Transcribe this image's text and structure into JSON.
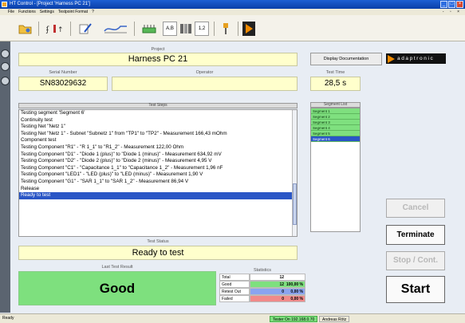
{
  "window": {
    "title": "HT Control - [Project 'Harness PC 21']"
  },
  "menu": {
    "items": [
      "File",
      "Functions",
      "Settings",
      "Testpoint Format",
      "?"
    ]
  },
  "toolbar": {
    "text_buttons": [
      "A,B",
      "1,2"
    ]
  },
  "project": {
    "label": "Project",
    "value": "Harness PC 21"
  },
  "serial": {
    "label": "Serial Number",
    "value": "SN83029632"
  },
  "operator": {
    "label": "Operator",
    "value": ""
  },
  "test_time": {
    "label": "Test Time",
    "value": "28,5 s"
  },
  "display_doc_button": "Display Documentation",
  "brand": {
    "name": "adaptronic",
    "accent": "#f08a00"
  },
  "test_steps": {
    "label": "Test Steps",
    "selected_index": 15,
    "lines": [
      "Testing segment 'Segment 6'",
      "Continuity test",
      "Testing Net \"Netz 1\"",
      "Testing Net \"Netz 1\" - Subnet \"Subnetz 1\" from \"TP1\" to \"TP2\" - Measurement 166,43 mOhm",
      "Component test",
      "Testing Component \"R1\" - \"R 1_1\" to \"R1_2\" - Measurement 122,00 Ohm",
      "Testing Component \"D1\" - \"Diode 1 (plus)\" to \"Diode 1 (minus)\" - Measurement 634,92 mV",
      "Testing Component \"D2\" - \"Diode 2 (plus)\" to \"Diode 2 (minus)\" - Measurement 4,95 V",
      "Testing Component \"C1\" - \"Capacitance 1_1\" to \"Capacitance 1_2\" - Measurement 1,96 nF",
      "Testing Component \"LED1\" - \"LED (plus)\" to \"LED (minus)\" - Measurement 1,90 V",
      "Testing Component \"G1\" - \"SAR 1_1\" to \"SAR 1_2\" - Measurement 86,94 V",
      "Release",
      "Ready to test"
    ]
  },
  "segment_list": {
    "label": "Segment List",
    "items": [
      "Segment 1",
      "Segment 2",
      "Segment 3",
      "Segment 4",
      "Segment 5",
      "Segment 6"
    ],
    "selected_index": 5
  },
  "test_status": {
    "label": "Test Status",
    "value": "Ready to test"
  },
  "last_result": {
    "label": "Last Test Result",
    "value": "Good",
    "color": "#7ee07e"
  },
  "statistics": {
    "label": "Statistics",
    "rows": [
      {
        "key": "Total",
        "count": "12",
        "percent": "",
        "color": "#ffffff"
      },
      {
        "key": "Good",
        "count": "12",
        "percent": "100,00 %",
        "color": "#7ee07e"
      },
      {
        "key": "Retest Out",
        "count": "0",
        "percent": "0,00 %",
        "color": "#8aa4f0"
      },
      {
        "key": "Failed",
        "count": "0",
        "percent": "0,00 %",
        "color": "#f08a8a"
      }
    ]
  },
  "actions": {
    "cancel": "Cancel",
    "terminate": "Terminate",
    "stop_cont": "Stop / Cont.",
    "start": "Start"
  },
  "statusbar": {
    "state": "Ready",
    "tester": "Tester On 192.168.0.70",
    "user": "Andreas Rötz"
  }
}
